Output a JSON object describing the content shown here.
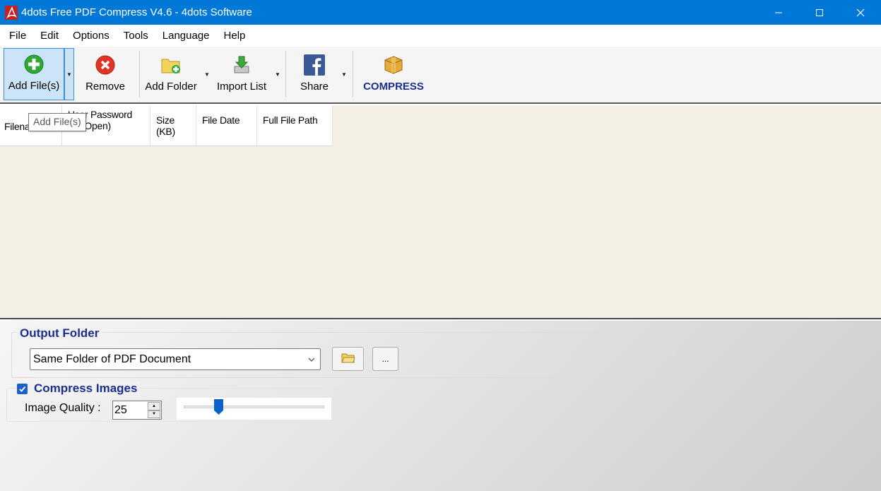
{
  "window": {
    "title": "4dots Free PDF Compress V4.6 - 4dots Software"
  },
  "menu": {
    "items": [
      "File",
      "Edit",
      "Options",
      "Tools",
      "Language",
      "Help"
    ]
  },
  "toolbar": {
    "add_files": "Add File(s)",
    "remove": "Remove",
    "add_folder": "Add Folder",
    "import_list": "Import List",
    "share": "Share",
    "compress": "COMPRESS"
  },
  "file_list": {
    "columns": [
      "Filena",
      "User Password (for Open)",
      "Size (KB)",
      "File Date",
      "Full File Path"
    ],
    "rows": [],
    "tooltip": "Add File(s)"
  },
  "output": {
    "group_title": "Output Folder",
    "selected": "Same Folder of PDF Document",
    "browse_label": "..."
  },
  "images": {
    "checkbox_label": "Compress Images",
    "checked": true,
    "quality_label": "Image Quality :",
    "quality_value": "25",
    "slider_fraction": 0.25
  },
  "colors": {
    "titlebar": "#0078d7",
    "accent_text": "#1b2f8f",
    "list_background": "#f3efe4"
  }
}
